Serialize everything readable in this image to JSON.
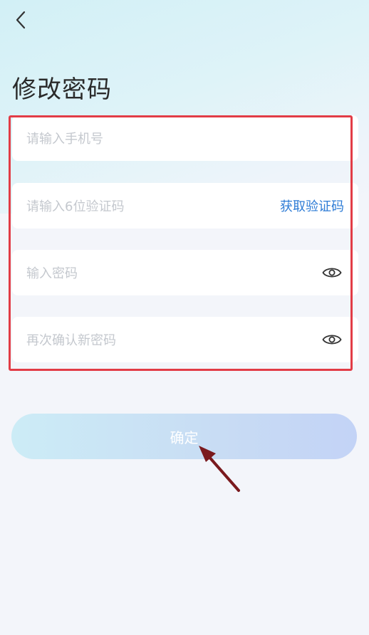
{
  "page": {
    "title": "修改密码"
  },
  "form": {
    "phone_placeholder": "请输入手机号",
    "code_placeholder": "请输入6位验证码",
    "get_code_label": "获取验证码",
    "password_placeholder": "输入密码",
    "confirm_password_placeholder": "再次确认新密码"
  },
  "actions": {
    "confirm_label": "确定"
  },
  "icons": {
    "back": "chevron-left-icon",
    "password_visibility": "eye-icon",
    "confirm_visibility": "eye-icon"
  },
  "colors": {
    "link": "#2e7cd6",
    "highlight_box": "#e23c46",
    "arrow": "#7a1a1e"
  }
}
